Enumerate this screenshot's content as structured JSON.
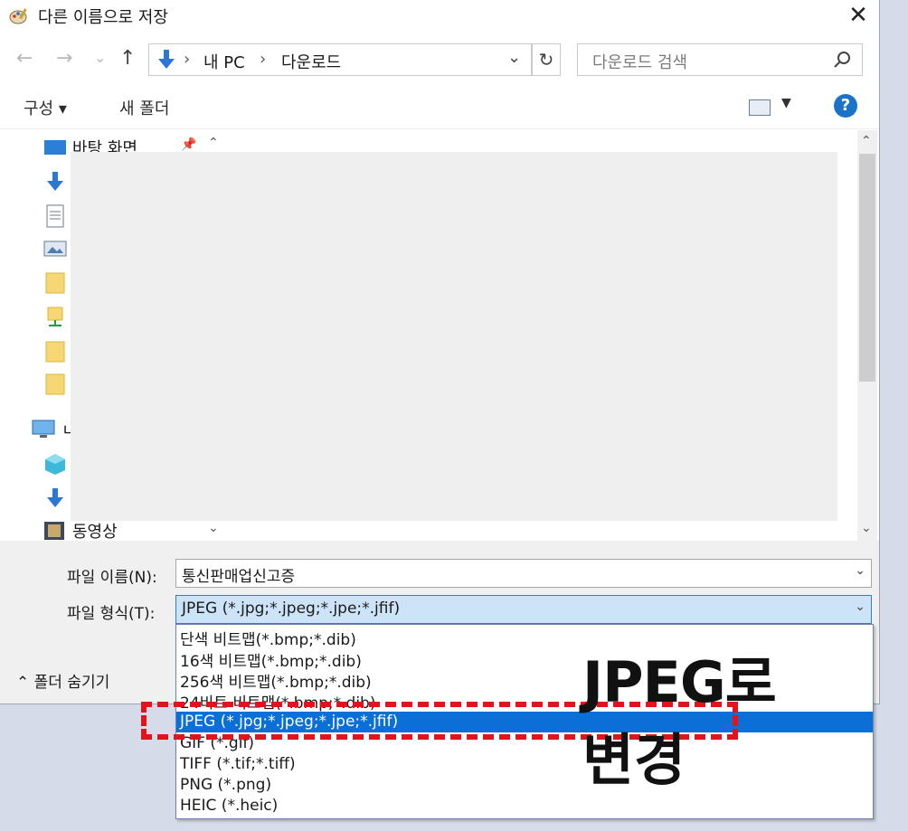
{
  "window": {
    "title": "다른 이름으로 저장",
    "close_glyph": "✕"
  },
  "nav": {
    "back": "←",
    "forward": "→",
    "recent": "⌄",
    "up": "↑"
  },
  "address": {
    "sep1": "›",
    "crumb1": "내 PC",
    "sep2": "›",
    "crumb2": "다운로드",
    "dropdown": "⌄",
    "refresh": "↻"
  },
  "search": {
    "placeholder": "다운로드 검색"
  },
  "commands": {
    "organize": "구성 ▾",
    "new_folder": "새 폴더",
    "view_dropdown": "▼",
    "help": "?"
  },
  "sidebar": {
    "items": [
      {
        "label": "바탕 화면",
        "icon": "desktop-icon"
      },
      {
        "label": "동영상",
        "icon": "video-icon"
      }
    ],
    "pc_partial": "ㄴ",
    "pin": "📌"
  },
  "form": {
    "filename_label": "파일 이름(N):",
    "filename_value": "통신판매업신고증",
    "filetype_label": "파일 형식(T):",
    "filetype_value": "JPEG (*.jpg;*.jpeg;*.jpe;*.jfif)",
    "toggle_label": "⌃  폴더 숨기기"
  },
  "filetype_options": [
    "단색 비트맵(*.bmp;*.dib)",
    "16색 비트맵(*.bmp;*.dib)",
    "256색 비트맵(*.bmp;*.dib)",
    "24비트 비트맵(*.bmp;*.dib)",
    "JPEG (*.jpg;*.jpeg;*.jpe;*.jfif)",
    "GIF (*.gif)",
    "TIFF (*.tif;*.tiff)",
    "PNG (*.png)",
    "HEIC (*.heic)"
  ],
  "annotation": {
    "line1": "JPEG로",
    "line2": "변경"
  }
}
